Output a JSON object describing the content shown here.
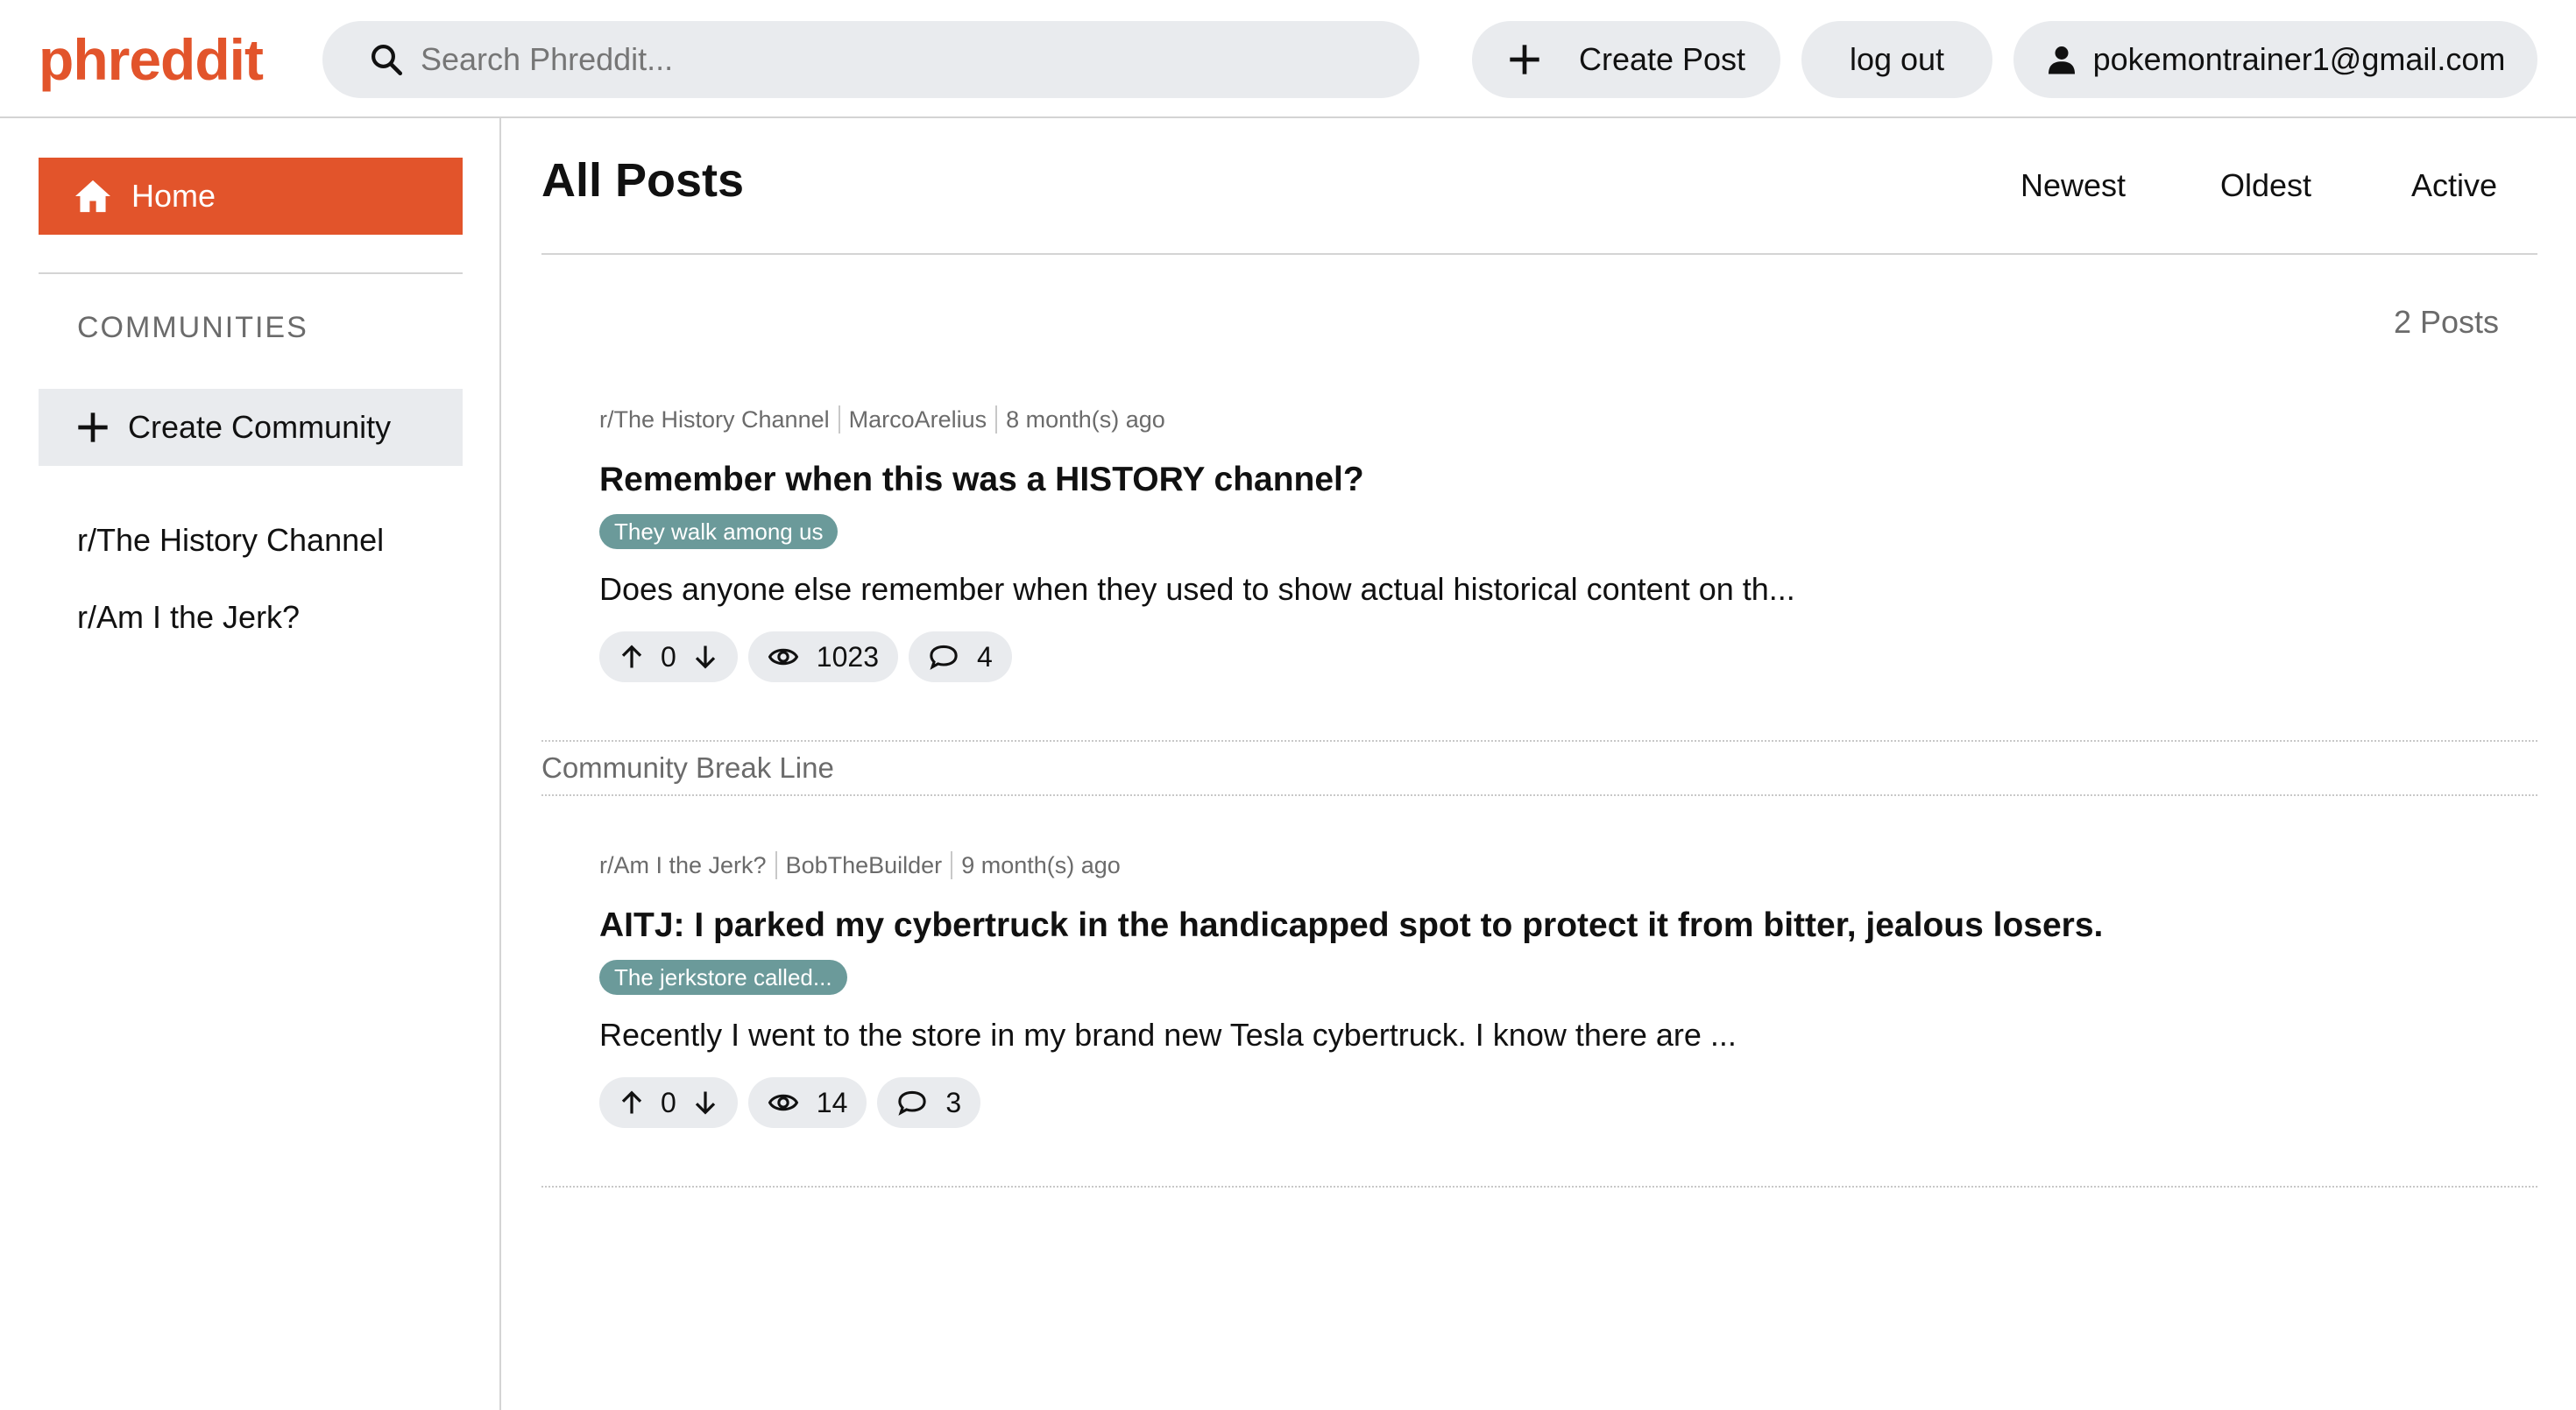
{
  "app": {
    "logo": "phreddit"
  },
  "header": {
    "search_placeholder": "Search Phreddit...",
    "create_post_label": "Create Post",
    "logout_label": "log out",
    "user_email": "pokemontrainer1@gmail.com"
  },
  "sidebar": {
    "home_label": "Home",
    "communities_heading": "COMMUNITIES",
    "create_community_label": "Create Community",
    "communities": [
      "r/The History Channel",
      "r/Am I the Jerk?"
    ]
  },
  "main": {
    "title": "All Posts",
    "sort_options": [
      "Newest",
      "Oldest",
      "Active"
    ],
    "post_count": "2 Posts",
    "posts": [
      {
        "community": "r/The History Channel",
        "author": "MarcoArelius",
        "time": "8 month(s) ago",
        "title": "Remember when this was a HISTORY channel?",
        "flair": "They walk among us",
        "body": "Does anyone else remember when they used to show actual historical content on th...",
        "votes": "0",
        "views": "1023",
        "comments": "4"
      },
      {
        "community": "r/Am I the Jerk?",
        "author": "BobTheBuilder",
        "time": "9 month(s) ago",
        "title": "AITJ: I parked my cybertruck in the handicapped spot to protect it from bitter, jealous losers.",
        "flair": "The jerkstore called...",
        "body": "Recently I went to the store in my brand new Tesla cybertruck. I know there are ...",
        "votes": "0",
        "views": "14",
        "comments": "3"
      }
    ],
    "break_line_label": "Community Break Line"
  },
  "colors": {
    "brand": "#e2542b",
    "pill_bg": "#e9ebee",
    "flair_bg": "#6b9a9a",
    "muted_text": "#6b6b6b"
  },
  "icons": [
    "search-icon",
    "plus-icon",
    "user-icon",
    "home-icon",
    "arrow-up-icon",
    "arrow-down-icon",
    "eye-icon",
    "comment-icon"
  ]
}
